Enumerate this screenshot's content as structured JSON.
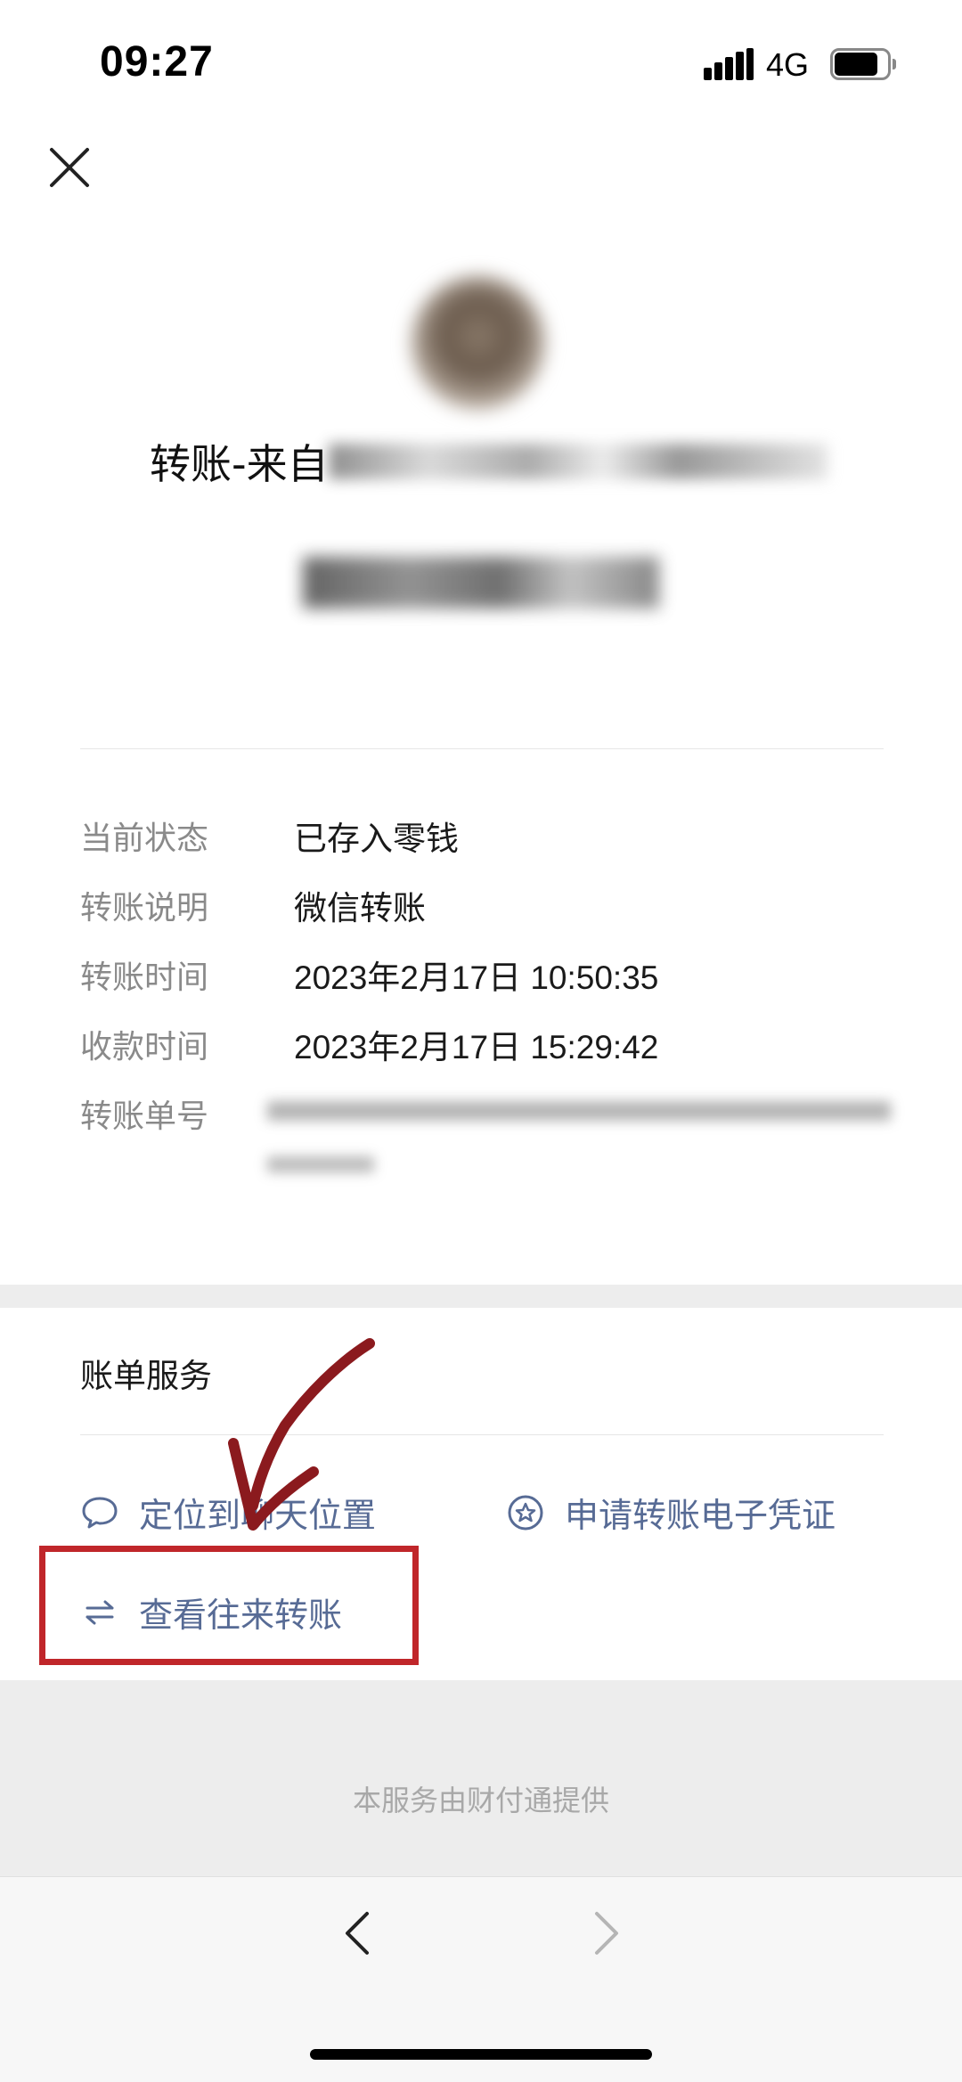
{
  "status_bar": {
    "time": "09:27",
    "network": "4G",
    "icons": [
      "signal-icon",
      "battery-icon"
    ]
  },
  "header": {
    "close_icon": "close-icon"
  },
  "transfer": {
    "sender_prefix": "转账-来自"
  },
  "details": [
    {
      "label": "当前状态",
      "value": "已存入零钱"
    },
    {
      "label": "转账说明",
      "value": "微信转账"
    },
    {
      "label": "转账时间",
      "value": "2023年2月17日 10:50:35"
    },
    {
      "label": "收款时间",
      "value": "2023年2月17日 15:29:42"
    },
    {
      "label": "转账单号",
      "value": ""
    }
  ],
  "services": {
    "title": "账单服务",
    "items": [
      {
        "label": "定位到聊天位置",
        "icon": "chat-bubble-icon"
      },
      {
        "label": "申请转账电子凭证",
        "icon": "star-badge-icon"
      },
      {
        "label": "查看往来转账",
        "icon": "transfer-arrows-icon"
      }
    ]
  },
  "footer": {
    "text": "本服务由财付通提供"
  },
  "nav": {
    "back_icon": "chevron-left-icon",
    "forward_icon": "chevron-right-icon"
  },
  "colors": {
    "link": "#576b95",
    "label": "#8a8a8a",
    "annotation": "#c0262a",
    "arrow": "#8b1a1e"
  }
}
